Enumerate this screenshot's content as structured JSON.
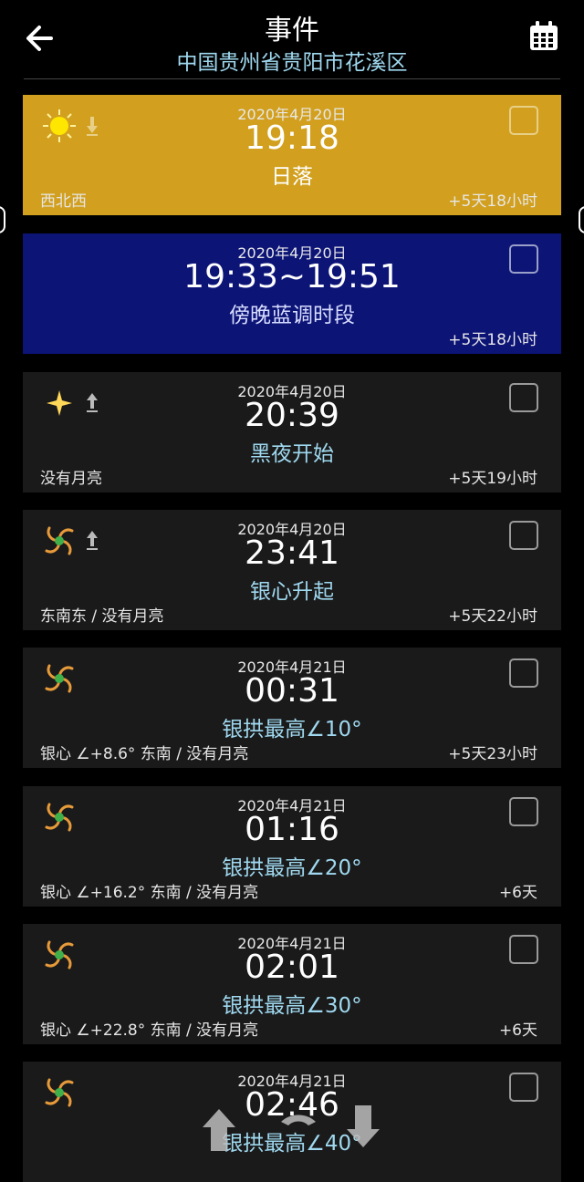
{
  "header": {
    "title": "事件",
    "subtitle": "中国贵州省贵阳市花溪区"
  },
  "colors": {
    "sunset_card": "#d2a01e",
    "bluehour_card": "#0c1476",
    "dark_card": "#1a1a1a",
    "accent_text": "#9fd8ef"
  },
  "events": [
    {
      "date": "2020年4月20日",
      "time": "19:18",
      "event": "日落",
      "left": "西北西",
      "right": "+5天18小时",
      "icon": "sun-icon",
      "arrow": "set-arrow-icon"
    },
    {
      "date": "2020年4月20日",
      "time": "19:33~19:51",
      "event": "傍晚蓝调时段",
      "left": "",
      "right": "+5天18小时",
      "icon": "",
      "arrow": ""
    },
    {
      "date": "2020年4月20日",
      "time": "20:39",
      "event": "黑夜开始",
      "left": "没有月亮",
      "right": "+5天19小时",
      "icon": "star-icon",
      "arrow": "rise-arrow-icon"
    },
    {
      "date": "2020年4月20日",
      "time": "23:41",
      "event": "银心升起",
      "left": "东南东 / 没有月亮",
      "right": "+5天22小时",
      "icon": "galaxy-icon",
      "arrow": "rise-arrow-icon"
    },
    {
      "date": "2020年4月21日",
      "time": "00:31",
      "event": "银拱最高∠10°",
      "left": "银心 ∠+8.6° 东南 / 没有月亮",
      "right": "+5天23小时",
      "icon": "galaxy-icon",
      "arrow": ""
    },
    {
      "date": "2020年4月21日",
      "time": "01:16",
      "event": "银拱最高∠20°",
      "left": "银心 ∠+16.2° 东南 / 没有月亮",
      "right": "+6天",
      "icon": "galaxy-icon",
      "arrow": ""
    },
    {
      "date": "2020年4月21日",
      "time": "02:01",
      "event": "银拱最高∠30°",
      "left": "银心 ∠+22.8° 东南 / 没有月亮",
      "right": "+6天",
      "icon": "galaxy-icon",
      "arrow": ""
    },
    {
      "date": "2020年4月21日",
      "time": "02:46",
      "event": "银拱最高∠40°",
      "left": "",
      "right": "",
      "icon": "galaxy-icon",
      "arrow": ""
    }
  ]
}
